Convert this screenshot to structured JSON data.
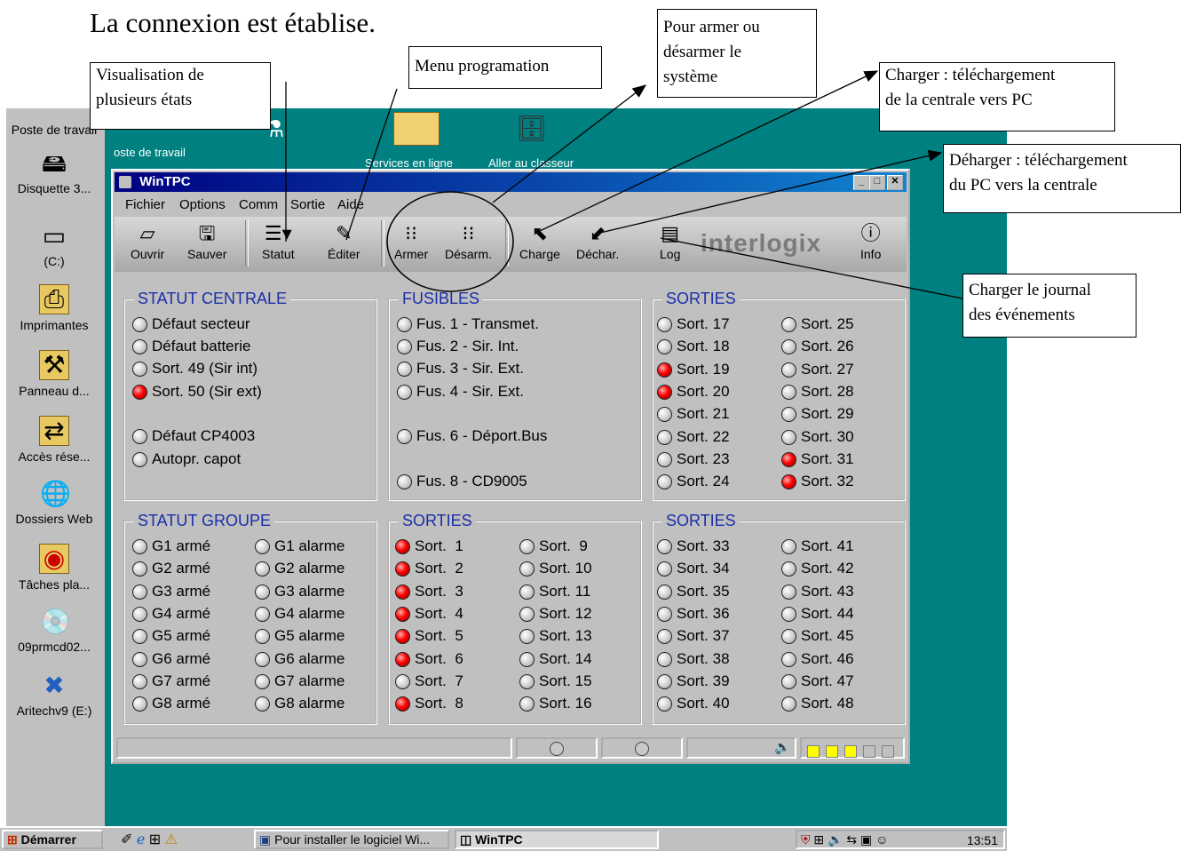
{
  "heading": "La connexion est établise.",
  "callouts": {
    "visualisation": [
      "Visualisation de",
      "plusieurs états"
    ],
    "programmation": [
      "Menu programation"
    ],
    "armer": [
      "Pour armer ou",
      "désarmer le",
      "système"
    ],
    "charger": [
      "Charger : téléchargement",
      "de la centrale vers PC"
    ],
    "decharger": [
      "Déharger : téléchargement",
      "du PC vers la centrale"
    ],
    "journal": [
      "Charger le journal",
      "des événements"
    ]
  },
  "desktop": {
    "icons": [
      {
        "label": "Poste de travail",
        "icon": "computer-icon"
      },
      {
        "label": "Disquette 3...",
        "icon": "floppy-icon"
      },
      {
        "label": "(C:)",
        "icon": "drive-icon"
      },
      {
        "label": "Imprimantes",
        "icon": "printer-icon"
      },
      {
        "label": "Panneau d...",
        "icon": "control-panel-icon"
      },
      {
        "label": "Accès rése...",
        "icon": "network-icon"
      },
      {
        "label": "Dossiers Web",
        "icon": "web-folder-icon"
      },
      {
        "label": "Tâches pla...",
        "icon": "tasks-icon"
      },
      {
        "label": "09prmcd02...",
        "icon": "cd-icon"
      },
      {
        "label": "Aritechv9 (E:)",
        "icon": "app-drive-icon"
      }
    ],
    "top_icons": [
      {
        "label": "oste de travail"
      },
      {
        "label": "Services en ligne"
      },
      {
        "label": "Aller au classeur"
      }
    ]
  },
  "window": {
    "title": "WinTPC",
    "menu": [
      "Fichier",
      "Options",
      "Comm",
      "Sortie",
      "Aide"
    ],
    "toolbar": [
      {
        "label": "Ouvrir",
        "icon": "open-icon"
      },
      {
        "label": "Sauver",
        "icon": "save-icon"
      },
      {
        "label": "Statut",
        "icon": "list-icon"
      },
      {
        "label": "Éditer",
        "icon": "edit-icon"
      },
      {
        "label": "Armer",
        "icon": "traffic-light-icon"
      },
      {
        "label": "Désarm.",
        "icon": "traffic-light-icon"
      },
      {
        "label": "Charge",
        "icon": "upload-icon"
      },
      {
        "label": "Déchar.",
        "icon": "download-icon"
      },
      {
        "label": "Log",
        "icon": "log-icon"
      },
      {
        "label": "Info",
        "icon": "info-icon"
      }
    ],
    "logo": "interlogix",
    "groups": {
      "statut_centrale": {
        "title": "STATUT CENTRALE",
        "items": [
          {
            "label": "Défaut secteur",
            "on": false
          },
          {
            "label": "Défaut batterie",
            "on": false
          },
          {
            "label": "Sort. 49 (Sir int)",
            "on": false
          },
          {
            "label": "Sort. 50 (Sir ext)",
            "on": true
          },
          {
            "label": "Défaut CP4003",
            "on": false
          },
          {
            "label": "Autopr. capot",
            "on": false
          }
        ]
      },
      "fusibles": {
        "title": "FUSIBLES",
        "items": [
          {
            "label": "Fus. 1 - Transmet.",
            "on": false
          },
          {
            "label": "Fus. 2 - Sir. Int.",
            "on": false
          },
          {
            "label": "Fus. 3 - Sir. Ext.",
            "on": false
          },
          {
            "label": "Fus. 4 - Sir. Ext.",
            "on": false
          },
          {
            "label": "Fus. 6 - Déport.Bus",
            "on": false
          },
          {
            "label": "Fus. 8 - CD9005",
            "on": false
          }
        ]
      },
      "sorties_top": {
        "title": "SORTIES",
        "col1": [
          {
            "label": "Sort. 17",
            "on": false
          },
          {
            "label": "Sort. 18",
            "on": false
          },
          {
            "label": "Sort. 19",
            "on": true
          },
          {
            "label": "Sort. 20",
            "on": true
          },
          {
            "label": "Sort. 21",
            "on": false
          },
          {
            "label": "Sort. 22",
            "on": false
          },
          {
            "label": "Sort. 23",
            "on": false
          },
          {
            "label": "Sort. 24",
            "on": false
          }
        ],
        "col2": [
          {
            "label": "Sort. 25",
            "on": false
          },
          {
            "label": "Sort. 26",
            "on": false
          },
          {
            "label": "Sort. 27",
            "on": false
          },
          {
            "label": "Sort. 28",
            "on": false
          },
          {
            "label": "Sort. 29",
            "on": false
          },
          {
            "label": "Sort. 30",
            "on": false
          },
          {
            "label": "Sort. 31",
            "on": true
          },
          {
            "label": "Sort. 32",
            "on": true
          }
        ]
      },
      "statut_groupe": {
        "title": "STATUT GROUPE",
        "col1": [
          {
            "label": "G1 armé",
            "on": false
          },
          {
            "label": "G2 armé",
            "on": false
          },
          {
            "label": "G3 armé",
            "on": false
          },
          {
            "label": "G4 armé",
            "on": false
          },
          {
            "label": "G5 armé",
            "on": false
          },
          {
            "label": "G6 armé",
            "on": false
          },
          {
            "label": "G7 armé",
            "on": false
          },
          {
            "label": "G8 armé",
            "on": false
          }
        ],
        "col2": [
          {
            "label": "G1 alarme",
            "on": false
          },
          {
            "label": "G2 alarme",
            "on": false
          },
          {
            "label": "G3 alarme",
            "on": false
          },
          {
            "label": "G4 alarme",
            "on": false
          },
          {
            "label": "G5 alarme",
            "on": false
          },
          {
            "label": "G6 alarme",
            "on": false
          },
          {
            "label": "G7 alarme",
            "on": false
          },
          {
            "label": "G8 alarme",
            "on": false
          }
        ]
      },
      "sorties_1_16": {
        "title": "SORTIES",
        "col1": [
          {
            "label": "Sort.  1",
            "on": true
          },
          {
            "label": "Sort.  2",
            "on": true
          },
          {
            "label": "Sort.  3",
            "on": true
          },
          {
            "label": "Sort.  4",
            "on": true
          },
          {
            "label": "Sort.  5",
            "on": true
          },
          {
            "label": "Sort.  6",
            "on": true
          },
          {
            "label": "Sort.  7",
            "on": false
          },
          {
            "label": "Sort.  8",
            "on": true
          }
        ],
        "col2": [
          {
            "label": "Sort.  9",
            "on": false
          },
          {
            "label": "Sort. 10",
            "on": false
          },
          {
            "label": "Sort. 11",
            "on": false
          },
          {
            "label": "Sort. 12",
            "on": false
          },
          {
            "label": "Sort. 13",
            "on": false
          },
          {
            "label": "Sort. 14",
            "on": false
          },
          {
            "label": "Sort. 15",
            "on": false
          },
          {
            "label": "Sort. 16",
            "on": false
          }
        ]
      },
      "sorties_33_48": {
        "title": "SORTIES",
        "col1": [
          {
            "label": "Sort. 33",
            "on": false
          },
          {
            "label": "Sort. 34",
            "on": false
          },
          {
            "label": "Sort. 35",
            "on": false
          },
          {
            "label": "Sort. 36",
            "on": false
          },
          {
            "label": "Sort. 37",
            "on": false
          },
          {
            "label": "Sort. 38",
            "on": false
          },
          {
            "label": "Sort. 39",
            "on": false
          },
          {
            "label": "Sort. 40",
            "on": false
          }
        ],
        "col2": [
          {
            "label": "Sort. 41",
            "on": false
          },
          {
            "label": "Sort. 42",
            "on": false
          },
          {
            "label": "Sort. 43",
            "on": false
          },
          {
            "label": "Sort. 44",
            "on": false
          },
          {
            "label": "Sort. 45",
            "on": false
          },
          {
            "label": "Sort. 46",
            "on": false
          },
          {
            "label": "Sort. 47",
            "on": false
          },
          {
            "label": "Sort. 48",
            "on": false
          }
        ]
      }
    },
    "statusbar": {
      "level_squares": [
        true,
        true,
        true,
        false,
        false
      ],
      "colors": {
        "active": "#ffff00",
        "inactive": "#c0c0c0"
      }
    }
  },
  "taskbar": {
    "start": "Démarrer",
    "tasks": [
      "Pour installer le logiciel Wi...",
      "WinTPC"
    ],
    "clock": "13:51"
  },
  "colors": {
    "led_on": "#ff0000",
    "group_title": "#1a2ea8",
    "desktop": "#008080",
    "titlebar": "#000080"
  }
}
